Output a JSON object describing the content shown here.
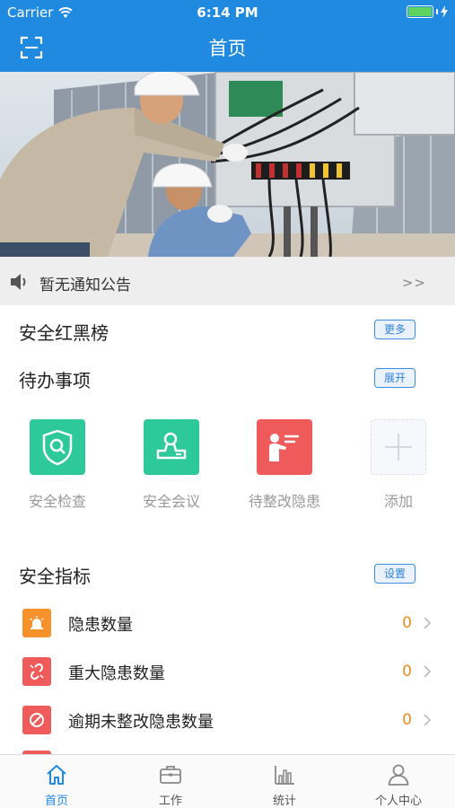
{
  "status_bar": {
    "carrier": "Carrier",
    "time": "6:14 PM"
  },
  "nav": {
    "title": "首页",
    "scan_icon": "scan-icon"
  },
  "banner": {
    "description_icon": "photo-banner-icon"
  },
  "notice": {
    "text": "暂无通知公告",
    "more": ">>"
  },
  "sections": {
    "rank": {
      "title": "安全红黑榜",
      "action": "更多"
    },
    "todo": {
      "title": "待办事项",
      "action": "展开"
    },
    "metrics": {
      "title": "安全指标",
      "action": "设置"
    }
  },
  "tasks": [
    {
      "label": "安全检查",
      "icon": "shield-search-icon",
      "color": "#2ec99a"
    },
    {
      "label": "安全会议",
      "icon": "meeting-stamp-icon",
      "color": "#2ec99a"
    },
    {
      "label": "待整改隐患",
      "icon": "presenter-board-icon",
      "color": "#ef5b5b"
    },
    {
      "label": "添加",
      "icon": "plus-icon",
      "color": "#d8e0ea"
    }
  ],
  "metrics": [
    {
      "name": "隐患数量",
      "count": "0",
      "icon": "alarm-bell-icon",
      "color": "#f5922b"
    },
    {
      "name": "重大隐患数量",
      "count": "0",
      "icon": "broken-link-icon",
      "color": "#ef5b5b"
    },
    {
      "name": "逾期未整改隐患数量",
      "count": "0",
      "icon": "forbidden-circle-icon",
      "color": "#ef5b5b"
    }
  ],
  "tabs": [
    {
      "label": "首页",
      "icon": "home-icon",
      "active": true
    },
    {
      "label": "工作",
      "icon": "briefcase-icon",
      "active": false
    },
    {
      "label": "统计",
      "icon": "bar-chart-icon",
      "active": false
    },
    {
      "label": "个人中心",
      "icon": "person-icon",
      "active": false
    }
  ],
  "colors": {
    "primary": "#1f8ae0",
    "accent_orange": "#f0891c",
    "green": "#2ec99a",
    "red": "#ef5b5b"
  }
}
